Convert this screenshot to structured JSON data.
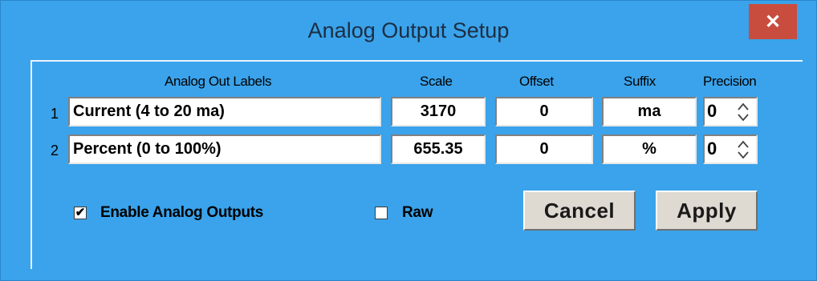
{
  "window": {
    "title": "Analog Output Setup",
    "close_glyph": "✕"
  },
  "headers": {
    "labels": "Analog Out Labels",
    "scale": "Scale",
    "offset": "Offset",
    "suffix": "Suffix",
    "precision": "Precision"
  },
  "rows": [
    {
      "num": "1",
      "label": "Current (4 to 20 ma)",
      "scale": "3170",
      "offset": "0",
      "suffix": "ma",
      "precision": "0"
    },
    {
      "num": "2",
      "label": "Percent (0 to 100%)",
      "scale": "655.35",
      "offset": "0",
      "suffix": "%",
      "precision": "0"
    }
  ],
  "options": {
    "enable_outputs": {
      "label": "Enable Analog  Outputs",
      "checked": true,
      "mark": "✔"
    },
    "raw": {
      "label": "Raw",
      "checked": false,
      "mark": ""
    }
  },
  "buttons": {
    "cancel": "Cancel",
    "apply": "Apply"
  },
  "colors": {
    "window_background": "#3aa3eb",
    "close_button": "#c94d3e",
    "button_face": "#ded9d1"
  }
}
